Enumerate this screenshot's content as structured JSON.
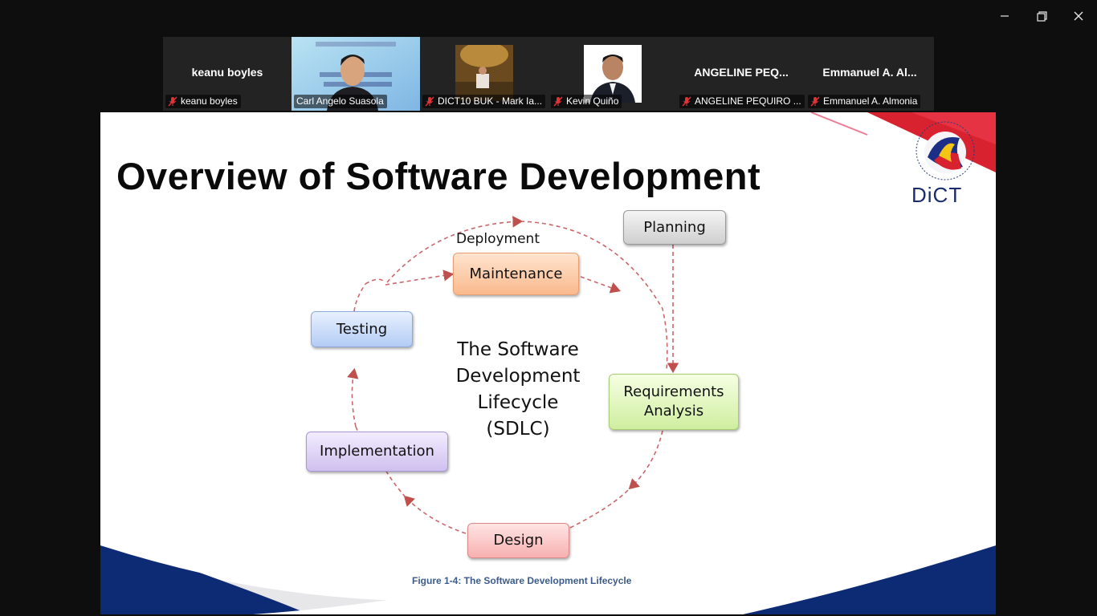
{
  "participants": [
    {
      "display_name": "keanu boyles",
      "label": "keanu boyles",
      "muted": true,
      "video": false
    },
    {
      "display_name": "",
      "label": "Carl Angelo Suasola",
      "muted": false,
      "video": true,
      "active_speaker": true
    },
    {
      "display_name": "",
      "label": "DICT10 BUK - Mark Ia...",
      "muted": true,
      "video": true
    },
    {
      "display_name": "",
      "label": "Kevin Quiño",
      "muted": true,
      "video": true
    },
    {
      "display_name": "ANGELINE PEQ...",
      "label": "ANGELINE PEQUIRO ...",
      "muted": true,
      "video": false
    },
    {
      "display_name": "Emmanuel A. Al...",
      "label": "Emmanuel A. Almonia",
      "muted": true,
      "video": false
    }
  ],
  "slide": {
    "title": "Overview of Software Development",
    "logo_text": "DiCT",
    "diagram": {
      "deployment_label": "Deployment",
      "center_lines": [
        "The Software",
        "Development",
        "Lifecycle",
        "(SDLC)"
      ],
      "stages": {
        "planning": "Planning",
        "requirements_line1": "Requirements",
        "requirements_line2": "Analysis",
        "design": "Design",
        "implementation": "Implementation",
        "testing": "Testing",
        "maintenance": "Maintenance"
      }
    },
    "caption": "Figure 1-4: The Software Development Lifecycle"
  },
  "colors": {
    "active_speaker_border": "#23d959",
    "muted_icon": "#e0343a",
    "accent_red": "#d8222f",
    "accent_blue": "#0d2b74"
  }
}
